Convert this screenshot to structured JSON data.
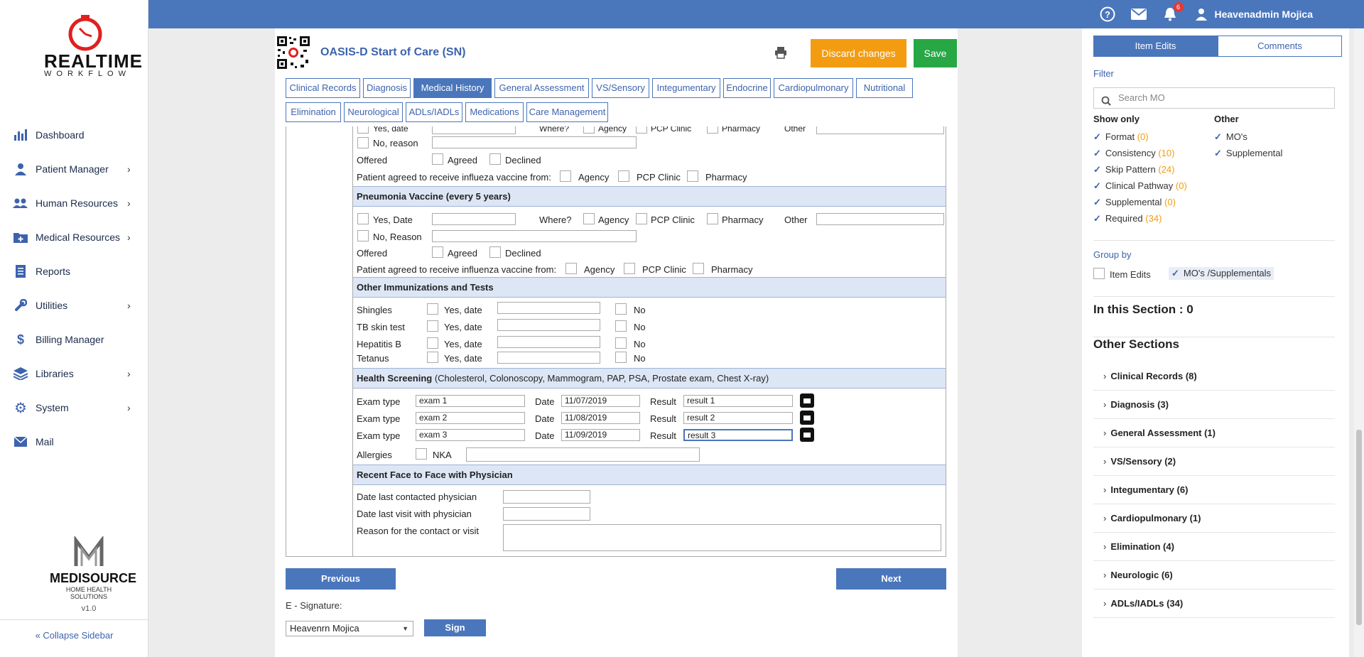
{
  "sidebar": {
    "logo_top": "REALTIME",
    "logo_bottom": "WORKFLOW",
    "items": [
      {
        "label": "Dashboard",
        "icon": "bar-chart-icon",
        "has_children": false
      },
      {
        "label": "Patient Manager",
        "icon": "user-icon",
        "has_children": true
      },
      {
        "label": "Human Resources",
        "icon": "users-icon",
        "has_children": true
      },
      {
        "label": "Medical Resources",
        "icon": "medical-folder-icon",
        "has_children": true
      },
      {
        "label": "Reports",
        "icon": "document-icon",
        "has_children": false
      },
      {
        "label": "Utilities",
        "icon": "wrench-icon",
        "has_children": true
      },
      {
        "label": "Billing Manager",
        "icon": "dollar-icon",
        "has_children": false
      },
      {
        "label": "Libraries",
        "icon": "layers-icon",
        "has_children": true
      },
      {
        "label": "System",
        "icon": "gear-icon",
        "has_children": true
      },
      {
        "label": "Mail",
        "icon": "mail-icon",
        "has_children": false
      }
    ],
    "brand_name": "MEDISOURCE",
    "brand_sub": "HOME HEALTH SOLUTIONS",
    "version": "v1.0",
    "collapse_label": "« Collapse Sidebar"
  },
  "topbar": {
    "notification_count": "6",
    "user_name": "Heavenadmin Mojica"
  },
  "header": {
    "form_title": "OASIS-D Start of Care (SN)",
    "discard_label": "Discard changes",
    "save_label": "Save"
  },
  "tabs": [
    "Clinical Records",
    "Diagnosis",
    "Medical History",
    "General Assessment",
    "VS/Sensory",
    "Integumentary",
    "Endocrine",
    "Cardiopulmonary",
    "Nutritional",
    "Elimination",
    "Neurological",
    "ADLs/IADLs",
    "Medications",
    "Care Management"
  ],
  "form": {
    "flu": {
      "yes_date": "Yes, date",
      "where": "Where?",
      "agency": "Agency",
      "pcp": "PCP Clinic",
      "pharmacy": "Pharmacy",
      "other": "Other",
      "no_reason": "No, reason",
      "offered": "Offered",
      "agreed": "Agreed",
      "declined": "Declined",
      "agreed_from": "Patient agreed to receive influeza vaccine from:"
    },
    "pneumonia": {
      "title": "Pneumonia Vaccine (every 5 years)",
      "yes_date": "Yes, Date",
      "where": "Where?",
      "agency": "Agency",
      "pcp": "PCP Clinic",
      "pharmacy": "Pharmacy",
      "other": "Other",
      "no_reason": "No, Reason",
      "offered": "Offered",
      "agreed": "Agreed",
      "declined": "Declined",
      "agreed_from": "Patient agreed to receive influenza vaccine from:"
    },
    "immunizations": {
      "title": "Other Immunizations and Tests",
      "yes_date": "Yes, date",
      "no": "No",
      "rows": [
        "Shingles",
        "TB skin test",
        "Hepatitis B",
        "Tetanus"
      ]
    },
    "screening": {
      "title": "Health Screening",
      "title_detail": "(Cholesterol, Colonoscopy, Mammogram, PAP, PSA, Prostate exam, Chest X-ray)",
      "exam_label": "Exam type",
      "date_label": "Date",
      "result_label": "Result",
      "rows": [
        {
          "exam": "exam 1",
          "date": "11/07/2019",
          "result": "result 1"
        },
        {
          "exam": "exam 2",
          "date": "11/08/2019",
          "result": "result 2"
        },
        {
          "exam": "exam 3",
          "date": "11/09/2019",
          "result": "result 3"
        }
      ],
      "allergies": "Allergies",
      "nka": "NKA"
    },
    "face": {
      "title": "Recent Face to Face with Physician",
      "last_contacted": "Date last contacted physician",
      "last_visit": "Date last visit with physician",
      "reason": "Reason for the contact or visit"
    }
  },
  "footer": {
    "previous": "Previous",
    "next": "Next",
    "esig_label": "E - Signature:",
    "signer": "Heavenrn Mojica",
    "sign": "Sign"
  },
  "right": {
    "tab_edits": "Item Edits",
    "tab_comments": "Comments",
    "filter": "Filter",
    "search_placeholder": "Search MO",
    "show_only": "Show only",
    "other": "Other",
    "show_items": [
      {
        "label": "Format",
        "count": "(0)"
      },
      {
        "label": "Consistency",
        "count": "(10)"
      },
      {
        "label": "Skip Pattern",
        "count": "(24)"
      },
      {
        "label": "Clinical Pathway",
        "count": "(0)"
      },
      {
        "label": "Supplemental",
        "count": "(0)"
      },
      {
        "label": "Required",
        "count": "(34)"
      }
    ],
    "other_items": [
      "MO's",
      "Supplemental"
    ],
    "group_by": "Group by",
    "group_item_edits": "Item Edits",
    "group_mos": "MO's /Supplementals",
    "in_section": "In this Section : 0",
    "other_sections": "Other Sections",
    "sections": [
      "Clinical Records (8)",
      "Diagnosis (3)",
      "General Assessment (1)",
      "VS/Sensory (2)",
      "Integumentary (6)",
      "Cardiopulmonary (1)",
      "Elimination (4)",
      "Neurologic (6)",
      "ADLs/IADLs (34)"
    ]
  },
  "colors": {
    "primary": "#4a76bc",
    "discard": "#f39c12",
    "save": "#28a745",
    "count": "#f39c12",
    "logo_red": "#e02020"
  }
}
